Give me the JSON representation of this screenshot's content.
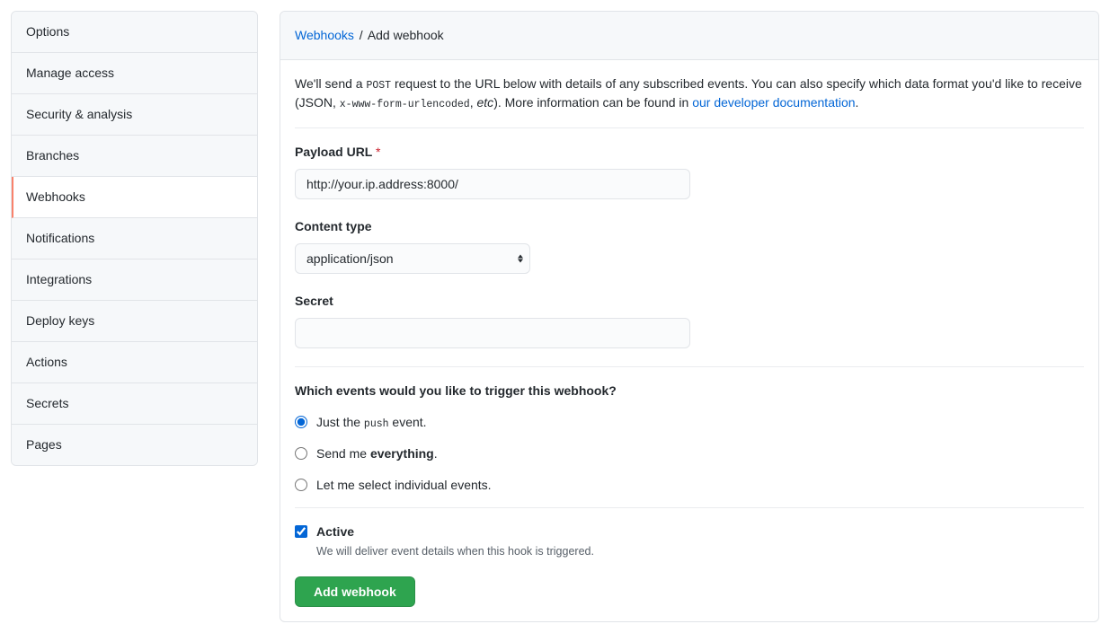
{
  "sidebar": {
    "items": [
      {
        "label": "Options",
        "active": false
      },
      {
        "label": "Manage access",
        "active": false
      },
      {
        "label": "Security & analysis",
        "active": false
      },
      {
        "label": "Branches",
        "active": false
      },
      {
        "label": "Webhooks",
        "active": true
      },
      {
        "label": "Notifications",
        "active": false
      },
      {
        "label": "Integrations",
        "active": false
      },
      {
        "label": "Deploy keys",
        "active": false
      },
      {
        "label": "Actions",
        "active": false
      },
      {
        "label": "Secrets",
        "active": false
      },
      {
        "label": "Pages",
        "active": false
      }
    ]
  },
  "breadcrumb": {
    "parent": "Webhooks",
    "separator": "/",
    "current": "Add webhook"
  },
  "intro": {
    "prefix": "We'll send a ",
    "code1": "POST",
    "mid1": " request to the URL below with details of any subscribed events. You can also specify which data format you'd like to receive (JSON, ",
    "code2": "x-www-form-urlencoded",
    "mid2": ", ",
    "em": "etc",
    "mid3": "). More information can be found in ",
    "link": "our developer documentation",
    "suffix": "."
  },
  "form": {
    "payload_url": {
      "label": "Payload URL",
      "required_mark": "*",
      "value": "http://your.ip.address:8000/"
    },
    "content_type": {
      "label": "Content type",
      "selected": "application/json"
    },
    "secret": {
      "label": "Secret",
      "value": ""
    },
    "events": {
      "heading": "Which events would you like to trigger this webhook?",
      "options": {
        "push": {
          "pre": "Just the ",
          "code": "push",
          "post": " event."
        },
        "everything": {
          "pre": "Send me ",
          "strong": "everything",
          "post": "."
        },
        "individual": {
          "text": "Let me select individual events."
        }
      }
    },
    "active": {
      "label": "Active",
      "description": "We will deliver event details when this hook is triggered."
    },
    "submit_label": "Add webhook"
  }
}
